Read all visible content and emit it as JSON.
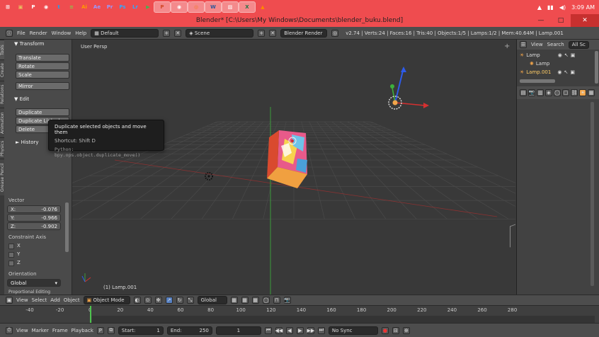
{
  "taskbar": {
    "apps": [
      {
        "icon": "windows-icon",
        "glyph": "⊞",
        "color": "#ffffff"
      },
      {
        "icon": "explorer-icon",
        "glyph": "▣",
        "color": "#e8c060"
      },
      {
        "icon": "pinterest-icon",
        "glyph": "P",
        "color": "#ffffff"
      },
      {
        "icon": "chrome-icon",
        "glyph": "◉",
        "color": "#ffffff"
      },
      {
        "icon": "twitter-icon",
        "glyph": "t",
        "color": "#1da1f2"
      },
      {
        "icon": "notepad-icon",
        "glyph": "≡",
        "color": "#8bc34a"
      },
      {
        "icon": "illustrator-icon",
        "glyph": "Ai",
        "color": "#ff9a00"
      },
      {
        "icon": "after-effects-icon",
        "glyph": "Ae",
        "color": "#9999ff"
      },
      {
        "icon": "premiere-icon",
        "glyph": "Pr",
        "color": "#9999ff"
      },
      {
        "icon": "photoshop-icon",
        "glyph": "Ps",
        "color": "#31a8ff"
      },
      {
        "icon": "lightroom-icon",
        "glyph": "Lr",
        "color": "#31a8ff"
      },
      {
        "icon": "camtasia-icon",
        "glyph": "▶",
        "color": "#4caf50"
      },
      {
        "icon": "powerpoint-icon",
        "glyph": "P",
        "color": "#d24726"
      },
      {
        "icon": "chrome-icon-2",
        "glyph": "◉",
        "color": "#ffffff"
      },
      {
        "icon": "blender-icon",
        "glyph": "◎",
        "color": "#f5792a"
      },
      {
        "icon": "word-icon",
        "glyph": "W",
        "color": "#2b579a"
      },
      {
        "icon": "paint-icon",
        "glyph": "▨",
        "color": "#ffffff"
      },
      {
        "icon": "excel-icon",
        "glyph": "X",
        "color": "#217346"
      },
      {
        "icon": "vlc-icon",
        "glyph": "▲",
        "color": "#ff8800"
      }
    ],
    "time": "3:09 AM"
  },
  "window": {
    "title": "Blender* [C:\\Users\\My Windows\\Documents\\blender_buku.blend]",
    "minimize": "—",
    "maximize": "□",
    "close": "✕"
  },
  "infobar": {
    "menus": [
      "File",
      "Render",
      "Window",
      "Help"
    ],
    "screen": "Default",
    "scene": "Scene",
    "engine": "Blender Render",
    "stats": "v2.74 | Verts:24 | Faces:16 | Tris:40 | Objects:1/5 | Lamps:1/2 | Mem:40.64M | Lamp.001"
  },
  "toolshelf": {
    "tabs": [
      "Tools",
      "Create",
      "Relations",
      "Animation",
      "Physics",
      "Grease Pencil"
    ],
    "transform_head": "▼ Transform",
    "transform_buttons": [
      "Translate",
      "Rotate",
      "Scale",
      "Mirror"
    ],
    "edit_head": "▼ Edit",
    "edit_buttons": [
      "Duplicate",
      "Duplicate Linked",
      "Delete"
    ],
    "history_head": "► History",
    "vector_head": "Vector",
    "vector": [
      {
        "label": "X:",
        "value": "-0.076"
      },
      {
        "label": "Y:",
        "value": "-0.966"
      },
      {
        "label": "Z:",
        "value": "-0.902"
      }
    ],
    "constraint_head": "Constraint Axis",
    "axes": [
      "X",
      "Y",
      "Z"
    ],
    "orientation_head": "Orientation",
    "orientation": "Global",
    "proportional_head": "Proportional Editing"
  },
  "viewport": {
    "view_label": "User Persp",
    "object_label": "(1) Lamp.001",
    "tooltip": {
      "title": "Duplicate selected objects and move them",
      "shortcut": "Shortcut: Shift D",
      "python": "Python: bpy.ops.object.duplicate_move()"
    },
    "colors": {
      "grid": "#4a4a4a",
      "x_axis": "#a03030",
      "y_axis": "#3c9a3c"
    }
  },
  "outliner": {
    "menus": [
      "View",
      "Search",
      "All Sc"
    ],
    "items": [
      {
        "name": "Lamp",
        "indent": 0
      },
      {
        "name": "Lamp",
        "indent": 1
      },
      {
        "name": "Lamp.001",
        "indent": 0
      }
    ]
  },
  "vp_header": {
    "menus": [
      "View",
      "Select",
      "Add",
      "Object"
    ],
    "mode": "Object Mode",
    "orientation": "Global"
  },
  "timeline": {
    "ruler": [
      "-40",
      "-20",
      "0",
      "20",
      "40",
      "60",
      "80",
      "100",
      "120",
      "140",
      "160",
      "180",
      "200",
      "220",
      "240",
      "260",
      "280"
    ],
    "menus": [
      "View",
      "Marker",
      "Frame",
      "Playback"
    ],
    "start": "Start:",
    "start_val": "1",
    "end": "End:",
    "end_val": "250",
    "current": "1",
    "sync": "No Sync"
  }
}
